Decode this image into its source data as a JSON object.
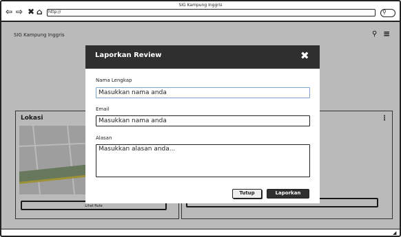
{
  "window": {
    "title": "SIG Kampung Inggris"
  },
  "browser": {
    "url": "http://",
    "icons": [
      "back-arrow-icon",
      "forward-arrow-icon",
      "close-x-icon",
      "home-icon",
      "search-icon"
    ]
  },
  "header": {
    "app_title": "SIG Kampung Inggris",
    "icons": [
      "search-icon",
      "menu-icon"
    ]
  },
  "cards": {
    "left": {
      "title": "Lokasi",
      "button_label": "Lihat Rute"
    }
  },
  "modal": {
    "title": "Laporkan Review",
    "fields": {
      "name": {
        "label": "Nama Lengkap",
        "value": "Masukkan nama anda"
      },
      "email": {
        "label": "Email",
        "value": "Masukkan nama anda"
      },
      "reason": {
        "label": "Alasan",
        "value": "Masukkan alasan anda..."
      }
    },
    "buttons": {
      "close": "Tutup",
      "submit": "Laporkan"
    }
  }
}
